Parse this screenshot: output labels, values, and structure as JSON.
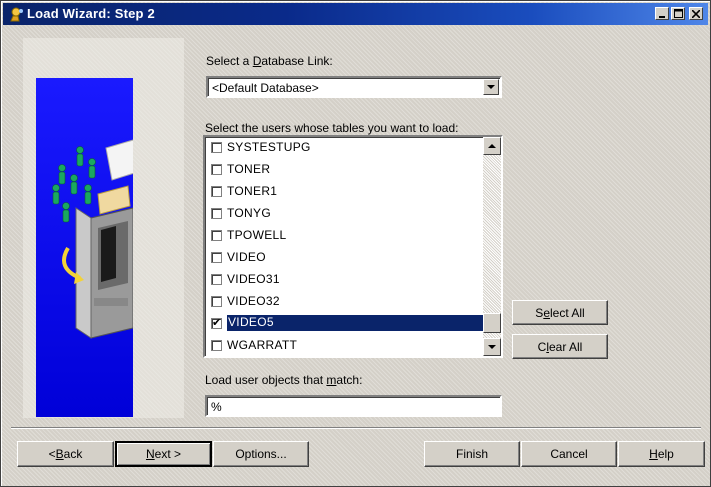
{
  "window": {
    "title": "Load Wizard: Step 2",
    "icon": "wizard-icon"
  },
  "db_link": {
    "label_pre": "Select a ",
    "label_key": "D",
    "label_post": "atabase Link:",
    "selected": "<Default Database>"
  },
  "users": {
    "label": "Select the users whose tables you want to load:",
    "items": [
      {
        "name": "SYSTESTUPG",
        "checked": false
      },
      {
        "name": "TONER",
        "checked": false
      },
      {
        "name": "TONER1",
        "checked": false
      },
      {
        "name": "TONYG",
        "checked": false
      },
      {
        "name": "TPOWELL",
        "checked": false
      },
      {
        "name": "VIDEO",
        "checked": false
      },
      {
        "name": "VIDEO31",
        "checked": false
      },
      {
        "name": "VIDEO32",
        "checked": false
      },
      {
        "name": "VIDEO5",
        "checked": true
      },
      {
        "name": "WGARRATT",
        "checked": false
      }
    ]
  },
  "select_all": {
    "pre": "S",
    "key": "e",
    "post": "lect All"
  },
  "clear_all": {
    "pre": "C",
    "key": "l",
    "post": "ear All"
  },
  "match": {
    "label_pre": "Load user objects that ",
    "label_key": "m",
    "label_post": "atch:",
    "value": "%"
  },
  "footer": {
    "back": {
      "pre": "< ",
      "key": "B",
      "post": "ack"
    },
    "next": {
      "pre": "",
      "key": "N",
      "post": "ext >"
    },
    "options": "Options...",
    "finish": "Finish",
    "cancel": "Cancel",
    "help": {
      "pre": "",
      "key": "H",
      "post": "elp"
    }
  },
  "colors": {
    "titlebar_start": "#0a246a",
    "titlebar_end": "#4f86e8",
    "selection": "#0a246a",
    "art_blue": "#0000d8"
  }
}
